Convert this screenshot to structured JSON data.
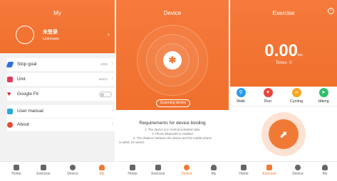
{
  "my": {
    "title": "My",
    "user_name": "未登录",
    "user_sub": "Unknown",
    "rows": [
      {
        "label": "Stop goal",
        "value": "4000",
        "icon": "shoe-icon",
        "color": "#2f6fdc"
      },
      {
        "label": "Unit",
        "value": "Metric",
        "icon": "ruler-icon",
        "color": "#e23a5a"
      },
      {
        "label": "Google Fit",
        "value": "",
        "icon": "heart-icon",
        "color": "#d81e2c"
      },
      {
        "label": "User manual",
        "value": "",
        "icon": "book-icon",
        "color": "#2ba8e0"
      },
      {
        "label": "About",
        "value": "",
        "icon": "info-icon",
        "color": "#e9492f"
      }
    ]
  },
  "device": {
    "title": "Device",
    "scan_label": "Scanning device",
    "req_title": "Requirements for device binding",
    "req_lines": [
      "1. The device is in normal activated state",
      "2. Phone Bluetooth is enabled",
      "3. The distance between the device and the mobile phone",
      "is within 10 meters"
    ]
  },
  "exercise": {
    "title": "Exercise",
    "distance": "0.00",
    "unit": "km",
    "times_label": "Times",
    "times_value": "0",
    "modes": [
      {
        "label": "Walk",
        "color": "#2b9be8",
        "icon": "walk-icon"
      },
      {
        "label": "Run",
        "color": "#e8453c",
        "icon": "run-icon"
      },
      {
        "label": "Cycling",
        "color": "#f5a623",
        "icon": "bike-icon"
      },
      {
        "label": "Hiking",
        "color": "#2fbf6b",
        "icon": "hike-icon"
      }
    ]
  },
  "tabs": [
    "Home",
    "Exercise",
    "Device",
    "My"
  ],
  "accent": "#f07a35"
}
